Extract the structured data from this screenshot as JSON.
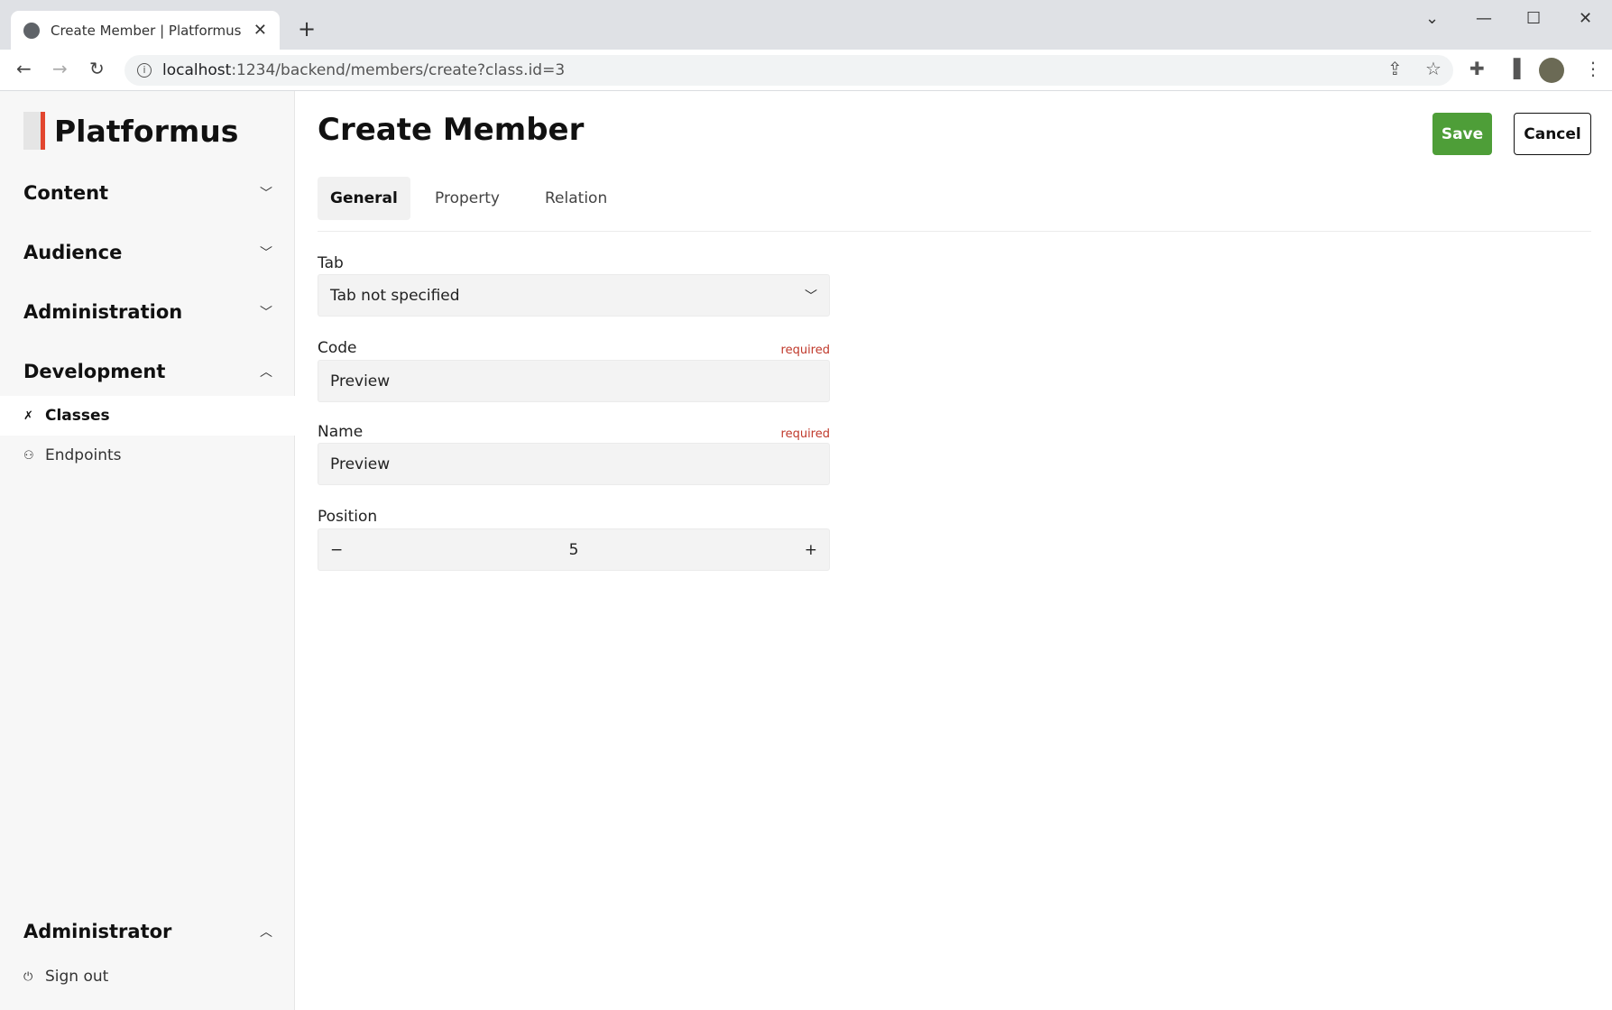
{
  "browser": {
    "tab_title": "Create Member | Platformus",
    "url_host": "localhost",
    "url_rest": ":1234/backend/members/create?class.id=3"
  },
  "sidebar": {
    "logo": "Platformus",
    "sections": [
      {
        "label": "Content"
      },
      {
        "label": "Audience"
      },
      {
        "label": "Administration"
      },
      {
        "label": "Development"
      }
    ],
    "dev_items": [
      {
        "label": "Classes"
      },
      {
        "label": "Endpoints"
      }
    ],
    "user_section": "Administrator",
    "sign_out": "Sign out"
  },
  "main": {
    "title": "Create Member",
    "save": "Save",
    "cancel": "Cancel",
    "tabs": [
      {
        "label": "General"
      },
      {
        "label": "Property"
      },
      {
        "label": "Relation"
      }
    ],
    "fields": {
      "tab": {
        "label": "Tab",
        "value": "Tab not specified"
      },
      "code": {
        "label": "Code",
        "required": "required",
        "value": "Preview"
      },
      "name": {
        "label": "Name",
        "required": "required",
        "value": "Preview"
      },
      "position": {
        "label": "Position",
        "value": "5"
      }
    }
  }
}
